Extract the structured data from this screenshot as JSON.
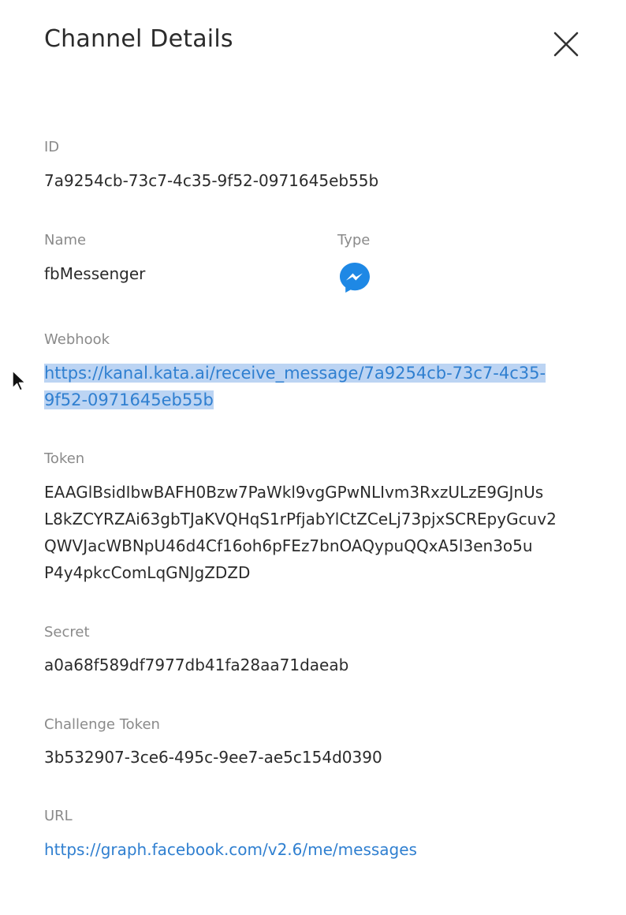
{
  "header": {
    "title": "Channel Details",
    "close_icon": "close-icon"
  },
  "fields": {
    "id": {
      "label": "ID",
      "value": "7a9254cb-73c7-4c35-9f52-0971645eb55b"
    },
    "name": {
      "label": "Name",
      "value": "fbMessenger"
    },
    "type": {
      "label": "Type",
      "icon": "messenger-icon"
    },
    "webhook": {
      "label": "Webhook",
      "lines": [
        "https://kanal.kata.ai/receive_message/7a9254cb-73c7-4c35-",
        "9f52-0971645eb55b"
      ]
    },
    "token": {
      "label": "Token",
      "lines": [
        "EAAGlBsidIbwBAFH0Bzw7PaWkl9vgGPwNLIvm3RxzULzE9GJnUs",
        "L8kZCYRZAi63gbTJaKVQHqS1rPfjabYlCtZCeLj73pjxSCREpyGcuv2",
        "QWVJacWBNpU46d4Cf16oh6pFEz7bnOAQypuQQxA5l3en3o5u",
        "P4y4pkcComLqGNJgZDZD"
      ]
    },
    "secret": {
      "label": "Secret",
      "value": "a0a68f589df7977db41fa28aa71daeab"
    },
    "challenge_token": {
      "label": "Challenge Token",
      "value": "3b532907-3ce6-495c-9ee7-ae5c154d0390"
    },
    "url": {
      "label": "URL",
      "value": "https://graph.facebook.com/v2.6/me/messages"
    }
  },
  "colors": {
    "link": "#2f7fd0",
    "selection": "#bcd4f3",
    "messenger": "#1e88e5",
    "label": "#8a8a8a",
    "text": "#2b2b2b"
  }
}
